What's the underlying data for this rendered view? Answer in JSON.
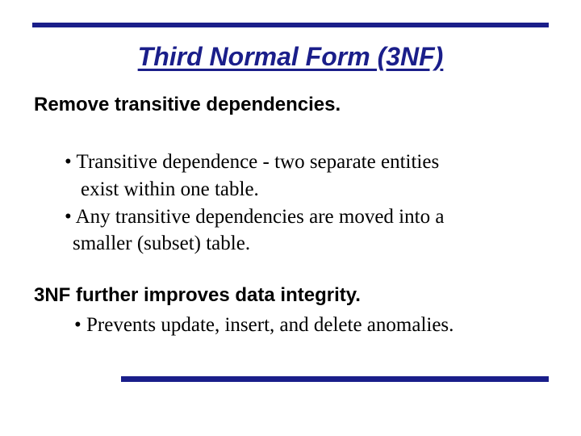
{
  "title": "Third Normal Form (3NF)",
  "subhead1": "Remove transitive dependencies.",
  "bullets1": {
    "l1": "• Transitive dependence - two separate entities",
    "l2": "exist within one table.",
    "l3": "• Any transitive dependencies are moved into a",
    "l4": "smaller (subset) table."
  },
  "subhead2": "3NF  further improves data integrity.",
  "bullets2": {
    "l1": "• Prevents update, insert, and delete anomalies."
  }
}
